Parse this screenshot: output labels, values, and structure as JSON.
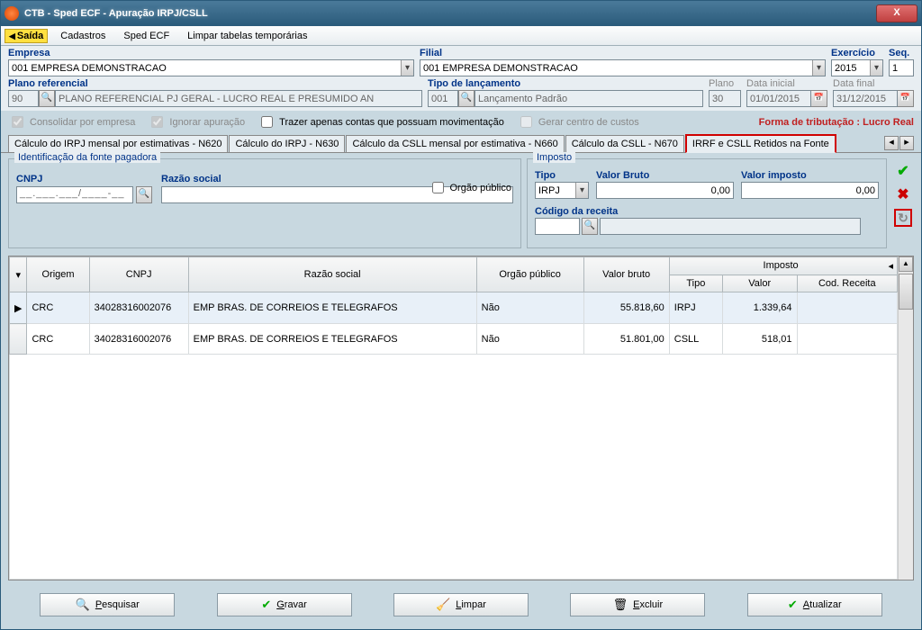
{
  "window": {
    "title": "CTB - Sped ECF - Apuração IRPJ/CSLL",
    "close_btn": "X"
  },
  "menu": {
    "saida": "Saída",
    "cadastros": "Cadastros",
    "sped_ecf": "Sped ECF",
    "limpar": "Limpar tabelas temporárias"
  },
  "labels": {
    "empresa": "Empresa",
    "filial": "Filial",
    "exercicio": "Exercício",
    "seq": "Seq.",
    "plano_ref": "Plano referencial",
    "tipo_lanc": "Tipo de lançamento",
    "plano": "Plano",
    "data_ini": "Data inicial",
    "data_fim": "Data final"
  },
  "values": {
    "empresa": "001 EMPRESA DEMONSTRACAO",
    "filial": "001 EMPRESA DEMONSTRACAO",
    "exercicio": "2015",
    "seq": "1",
    "plano_ref_code": "90",
    "plano_ref_desc": "PLANO REFERENCIAL PJ GERAL - LUCRO REAL E PRESUMIDO AN",
    "tipo_lanc_code": "001",
    "tipo_lanc_desc": "Lançamento Padrão",
    "plano": "30",
    "data_ini": "01/01/2015",
    "data_fim": "31/12/2015"
  },
  "checks": {
    "consolidar": "Consolidar por empresa",
    "ignorar": "Ignorar apuração",
    "trazer": "Trazer apenas contas que possuam movimentação",
    "gerar_cc": "Gerar centro de custos"
  },
  "tax_form": {
    "label": "Forma de tributação : Lucro Real"
  },
  "tabs": {
    "t1": "Cálculo do IRPJ mensal por estimativas - N620",
    "t2": "Cálculo do IRPJ - N630",
    "t3": "Cálculo da CSLL mensal por estimativa - N660",
    "t4": "Cálculo da CSLL - N670",
    "t5": "IRRF e CSLL Retidos na Fonte"
  },
  "identif": {
    "legend": "Identificação da fonte pagadora",
    "cnpj_label": "CNPJ",
    "cnpj_mask": "__.___.___/____-__",
    "razao_label": "Razão social",
    "orgao_label": "Orgão público"
  },
  "imposto": {
    "legend": "Imposto",
    "tipo_label": "Tipo",
    "tipo_value": "IRPJ",
    "valor_bruto_label": "Valor Bruto",
    "valor_bruto_value": "0,00",
    "valor_imp_label": "Valor imposto",
    "valor_imp_value": "0,00",
    "codigo_label": "Código da receita"
  },
  "grid": {
    "headers": {
      "origem": "Origem",
      "cnpj": "CNPJ",
      "razao": "Razão social",
      "orgao": "Orgão público",
      "valor_bruto": "Valor bruto",
      "imposto": "Imposto",
      "tipo": "Tipo",
      "valor": "Valor",
      "cod_receita": "Cod. Receita"
    },
    "rows": [
      {
        "origem": "CRC",
        "cnpj": "34028316002076",
        "razao": "EMP BRAS. DE CORREIOS E TELEGRAFOS",
        "orgao": "Não",
        "valor_bruto": "55.818,60",
        "tipo": "IRPJ",
        "valor": "1.339,64",
        "cod": ""
      },
      {
        "origem": "CRC",
        "cnpj": "34028316002076",
        "razao": "EMP BRAS. DE CORREIOS E TELEGRAFOS",
        "orgao": "Não",
        "valor_bruto": "51.801,00",
        "tipo": "CSLL",
        "valor": "518,01",
        "cod": ""
      }
    ]
  },
  "buttons": {
    "pesquisar": "Pesquisar",
    "gravar": "Gravar",
    "limpar": "Limpar",
    "excluir": "Excluir",
    "atualizar": "Atualizar"
  }
}
